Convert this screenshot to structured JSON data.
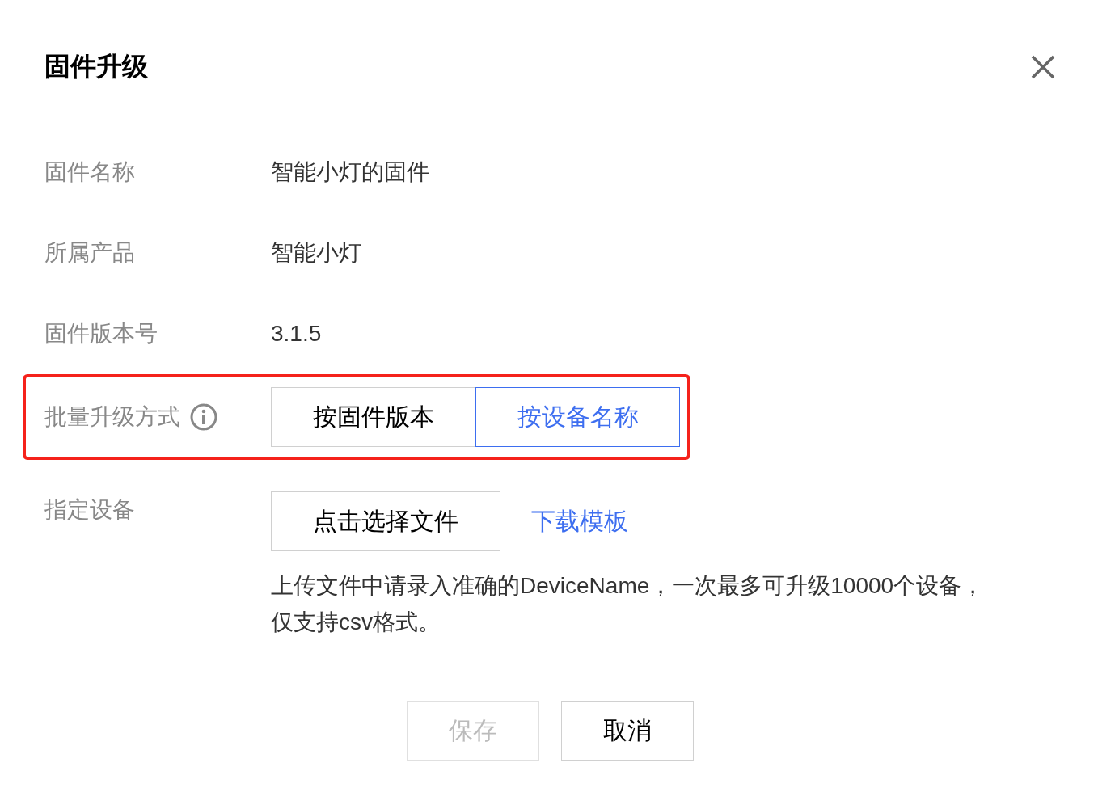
{
  "dialog": {
    "title": "固件升级"
  },
  "fields": [
    {
      "label": "固件名称",
      "value": "智能小灯的固件"
    },
    {
      "label": "所属产品",
      "value": "智能小灯"
    },
    {
      "label": "固件版本号",
      "value": "3.1.5"
    }
  ],
  "upgrade_mode": {
    "label": "批量升级方式",
    "highlighted": true,
    "options": [
      {
        "label": "按固件版本",
        "selected": false
      },
      {
        "label": "按设备名称",
        "selected": true
      }
    ]
  },
  "device": {
    "label": "指定设备",
    "file_button": "点击选择文件",
    "template_link": "下载模板",
    "hint": "上传文件中请录入准确的DeviceName，一次最多可升级10000个设备，仅支持csv格式。"
  },
  "buttons": [
    {
      "label": "保存",
      "disabled": true
    },
    {
      "label": "取消",
      "disabled": false
    }
  ]
}
